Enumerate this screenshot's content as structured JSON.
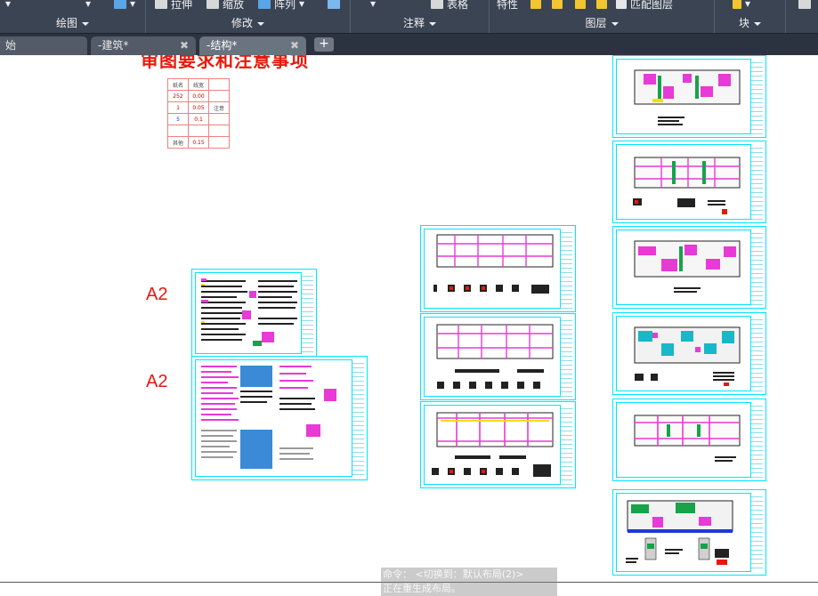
{
  "ribbon": {
    "panels": [
      {
        "label": "绘图",
        "tools": []
      },
      {
        "label": "修改",
        "tools": [
          "拉伸",
          "缩放",
          "阵列"
        ]
      },
      {
        "label": "注释",
        "tools": [
          "表格"
        ]
      },
      {
        "label": "图层",
        "tools": [
          "特性",
          "匹配图层"
        ]
      },
      {
        "label": "块",
        "tools": []
      }
    ]
  },
  "tabs": [
    {
      "label": "始"
    },
    {
      "label": "-建筑*"
    },
    {
      "label": "-结构*",
      "active": true
    }
  ],
  "new_tab_label": "+",
  "canvas": {
    "title_text": "审图要求和注意事项",
    "sheet_size_labels": [
      "A2",
      "A2"
    ],
    "scale_table": {
      "header": [
        "纸名",
        "线宽"
      ],
      "rows": [
        [
          "252",
          "0.00",
          ""
        ],
        [
          "1",
          "0.05",
          "注意"
        ],
        [
          "5",
          "0.1",
          ""
        ],
        [
          "",
          "",
          ""
        ],
        [
          "其他",
          "0.15",
          ""
        ]
      ]
    }
  },
  "command_line": {
    "lines": [
      "命令：  <切换到：默认布局(2)>",
      "正在重生成布局。"
    ]
  },
  "colors": {
    "ribbon_bg": "#3b4453",
    "tabbar_bg": "#2c3340",
    "sheet_border": "#00e5ff",
    "annotation_red": "#e8180c"
  }
}
